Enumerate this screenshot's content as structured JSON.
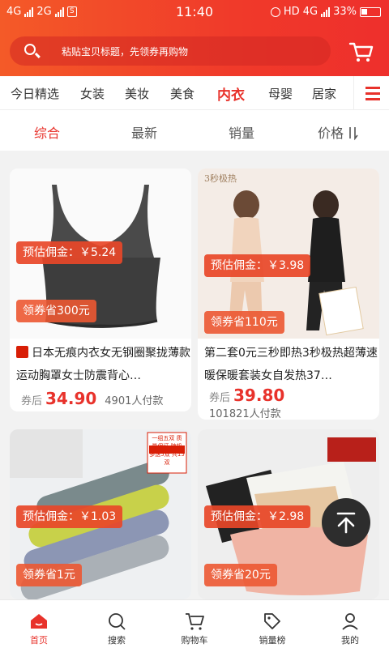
{
  "status_bar": {
    "carrier1": "4G",
    "carrier2": "2G",
    "sim_icon_label": "S",
    "time": "11:40",
    "network": "HD 4G",
    "battery": "33%"
  },
  "search": {
    "placeholder": "粘贴宝贝标题，先领券再购物"
  },
  "categories": [
    "今日精选",
    "女装",
    "美妆",
    "美食",
    "内衣",
    "母婴",
    "居家"
  ],
  "active_category": "内衣",
  "sort_options": [
    "综合",
    "最新",
    "销量",
    "价格"
  ],
  "active_sort": "综合",
  "products": [
    {
      "commission": "预估佣金：￥5.24",
      "coupon": "领券省300元",
      "title": "日本无痕内衣女无钢圈聚拢薄款运动胸罩女士防震背心…",
      "price_prefix": "券后",
      "price": "34.90",
      "sold": "4901人付款"
    },
    {
      "commission": "预估佣金：￥3.98",
      "coupon": "领券省110元",
      "title": "第二套0元三秒即热3秒极热超薄速暖保暖套装女自发热37…",
      "price_prefix": "券后",
      "price": "39.80",
      "sold": "101821人付款",
      "image_text": "3秒极热"
    },
    {
      "commission": "预估佣金：￥1.03",
      "coupon": "领券省1元",
      "image_text": "一组五双 质量保证 随机多送5双 共15双"
    },
    {
      "commission": "预估佣金：￥2.98",
      "coupon": "领券省20元"
    }
  ],
  "tabbar": [
    "首页",
    "搜索",
    "购物车",
    "销量榜",
    "我的"
  ],
  "active_tab": "首页",
  "colors": {
    "brand": "#e8322b",
    "header_gradient_start": "#f45a28",
    "header_gradient_end": "#ee2f2c"
  }
}
